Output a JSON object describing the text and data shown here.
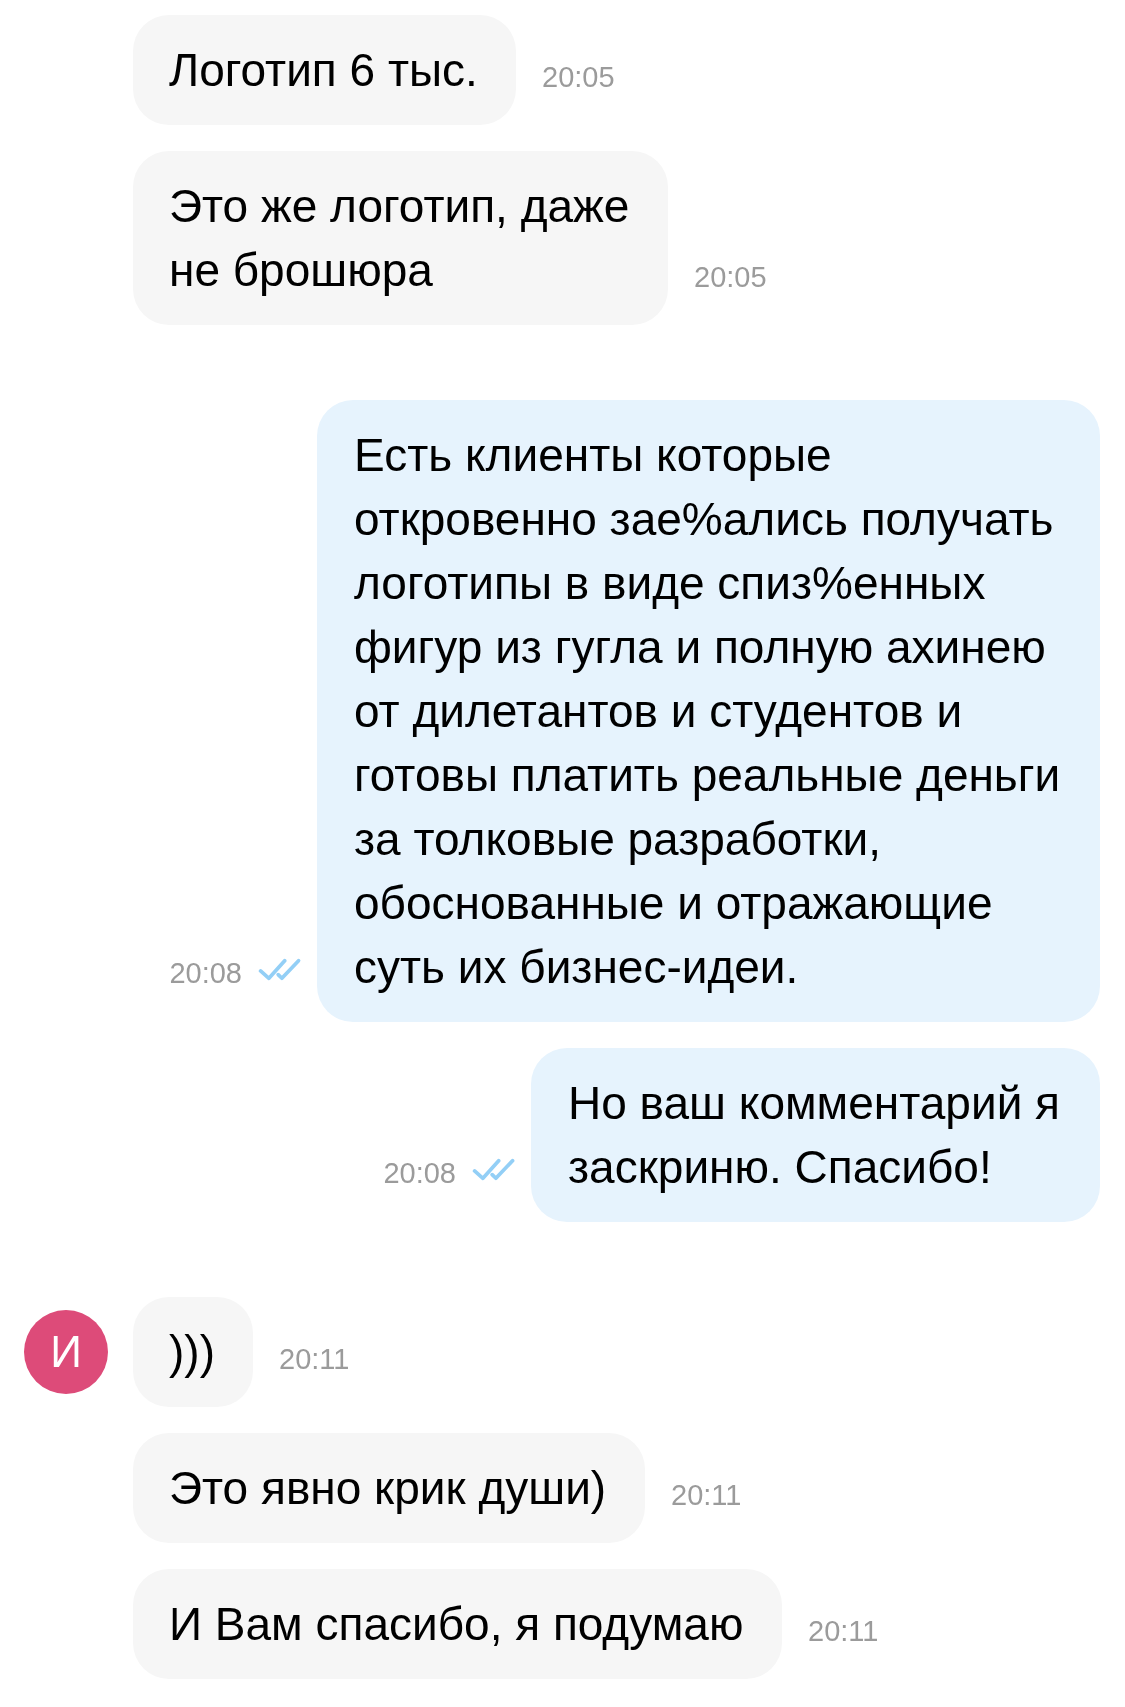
{
  "messages": [
    {
      "kind": "incoming",
      "text": "Логотип 6 тыс.",
      "time": "20:05"
    },
    {
      "kind": "incoming",
      "text": "Это же логотип, даже\nне брошюра",
      "time": "20:05"
    },
    {
      "kind": "outgoing",
      "text": "Есть клиенты которые откровенно зае%ались получать логотипы в виде спиз%енных фигур из гугла и полную ахинею от дилетантов и студентов и готовы платить реальные деньги за толковые разработки, обоснованные и отражающие суть их бизнес-идеи.",
      "time": "20:08",
      "read": true
    },
    {
      "kind": "outgoing",
      "text": "Но ваш комментарий я заскриню. Спасибо!",
      "time": "20:08",
      "read": true
    },
    {
      "kind": "incoming",
      "avatar": "И",
      "text": ")))",
      "time": "20:11"
    },
    {
      "kind": "incoming",
      "text": "Это явно крик души)",
      "time": "20:11"
    },
    {
      "kind": "incoming",
      "text": "И Вам спасибо, я подумаю",
      "time": "20:11"
    }
  ]
}
